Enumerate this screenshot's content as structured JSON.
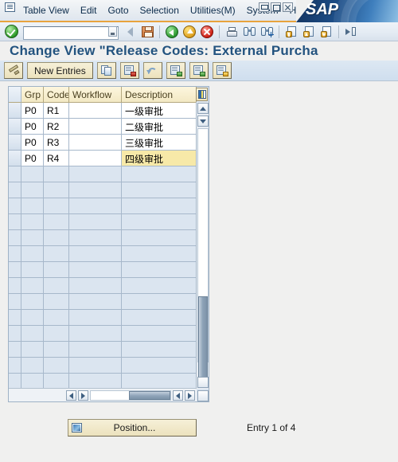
{
  "window": {
    "system_menu_icon": "system-menu-icon",
    "controls": [
      {
        "name": "minimize-button",
        "glyph": "minimize"
      },
      {
        "name": "restore-button",
        "glyph": "restore"
      },
      {
        "name": "close-button",
        "glyph": "close"
      }
    ],
    "brand": "SAP"
  },
  "menubar": {
    "items": [
      {
        "label": "Table View"
      },
      {
        "label": "Edit"
      },
      {
        "label": "Goto"
      },
      {
        "label": "Selection"
      },
      {
        "label": "Utilities(M)"
      },
      {
        "label": "System"
      },
      {
        "label": "Help"
      }
    ]
  },
  "toolbar": {
    "enter_icon": "enter-check-icon",
    "command_field": {
      "value": "",
      "placeholder": ""
    },
    "command_dropdown_icon": "chevron-down-icon",
    "buttons": [
      {
        "name": "back-nav-arrow-icon",
        "glyph": "left-arrow"
      },
      {
        "name": "save-icon",
        "glyph": "save"
      },
      {
        "name": "back-icon",
        "glyph": "green-back"
      },
      {
        "name": "exit-icon",
        "glyph": "yellow-up"
      },
      {
        "name": "cancel-icon",
        "glyph": "red-cancel"
      },
      {
        "name": "print-icon",
        "glyph": "printer"
      },
      {
        "name": "find-icon",
        "glyph": "binoculars"
      },
      {
        "name": "find-next-icon",
        "glyph": "binoculars-plus"
      },
      {
        "name": "first-page-icon",
        "glyph": "page-first"
      },
      {
        "name": "previous-page-icon",
        "glyph": "page-prev"
      },
      {
        "name": "next-page-icon",
        "glyph": "page-next"
      },
      {
        "name": "last-page-icon",
        "glyph": "page-last"
      }
    ]
  },
  "page": {
    "title": "Change View \"Release Codes: External Purcha"
  },
  "apptoolbar": {
    "buttons": [
      {
        "name": "display-change-button",
        "label": "",
        "icon": "pencil-icon"
      },
      {
        "name": "new-entries-button",
        "label": "New Entries",
        "icon": ""
      },
      {
        "name": "copy-as-button",
        "label": "",
        "icon": "copy-icon"
      },
      {
        "name": "delete-button",
        "label": "",
        "icon": "sheet-red-icon"
      },
      {
        "name": "undo-button",
        "label": "",
        "icon": "undo-icon"
      },
      {
        "name": "select-all-button",
        "label": "",
        "icon": "sheet-green-icon"
      },
      {
        "name": "select-block-button",
        "label": "",
        "icon": "sheet-green2-icon"
      },
      {
        "name": "deselect-all-button",
        "label": "",
        "icon": "sheet-yellow-icon"
      }
    ]
  },
  "table": {
    "config_icon": "grid-config-icon",
    "columns": [
      {
        "key": "grp",
        "label": "Grp"
      },
      {
        "key": "code",
        "label": "Code"
      },
      {
        "key": "workflow",
        "label": "Workflow"
      },
      {
        "key": "description",
        "label": "Description"
      }
    ],
    "rows": [
      {
        "grp": "P0",
        "code": "R1",
        "workflow": "",
        "description": "一级审批",
        "selected": false
      },
      {
        "grp": "P0",
        "code": "R2",
        "workflow": "",
        "description": "二级审批",
        "selected": false
      },
      {
        "grp": "P0",
        "code": "R3",
        "workflow": "",
        "description": "三级审批",
        "selected": false
      },
      {
        "grp": "P0",
        "code": "R4",
        "workflow": "",
        "description": "四级审批",
        "selected": true
      }
    ],
    "empty_row_count": 14,
    "vertical_scrollbar": {
      "up_arrow_icon": "scroll-up-icon",
      "down_arrow_icon": "scroll-down-icon"
    },
    "horizontal_scrollbar": {
      "left_arrow_icon": "scroll-left-icon",
      "right_arrow_icon": "scroll-right-icon"
    }
  },
  "footer": {
    "position_button": {
      "label": "Position...",
      "icon": "position-icon"
    },
    "entry_status": "Entry 1 of 4"
  },
  "colors": {
    "title_blue": "#23537f",
    "accent_orange": "#e8a33d",
    "header_cream": "#f3e9c4",
    "selected_row": "#f7e9a8",
    "grid_bg": "#dbe5f0"
  }
}
